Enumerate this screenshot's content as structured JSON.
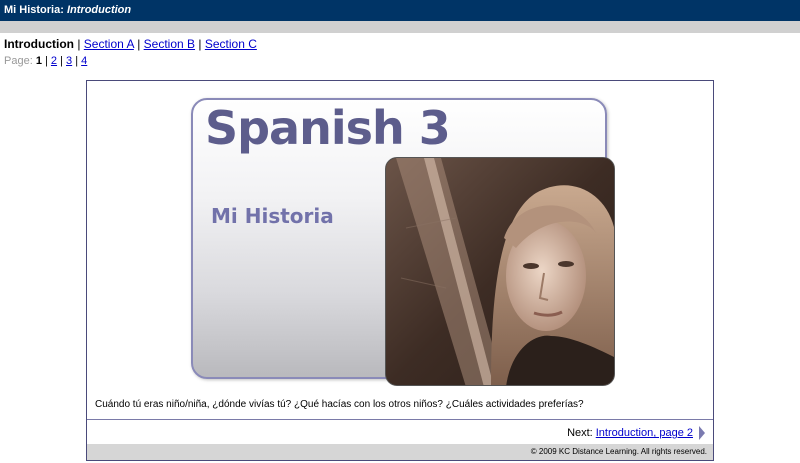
{
  "header": {
    "title": "Mi Historia:",
    "subtitle": "Introduction"
  },
  "nav": {
    "current": "Introduction",
    "separator": "|",
    "links": [
      "Section A",
      "Section B",
      "Section C"
    ]
  },
  "pager": {
    "label": "Page:",
    "current": "1",
    "pages": [
      "2",
      "3",
      "4"
    ],
    "separator": "|"
  },
  "card": {
    "title": "Spanish 3",
    "subtitle": "Mi Historia"
  },
  "content": {
    "question": "Cuándo tú eras niño/niña, ¿dónde vivías tú? ¿Qué hacías con los otros niños? ¿Cuáles actividades preferías?"
  },
  "footer_nav": {
    "next_label": "Next:",
    "next_link": "Introduction, page 2",
    "copyright": "© 2009 KC Distance Learning. All rights reserved."
  },
  "colors": {
    "titlebar": "#003466",
    "link": "#0000cc",
    "card_title": "#5d5d8c",
    "card_subtitle": "#7272aa"
  }
}
